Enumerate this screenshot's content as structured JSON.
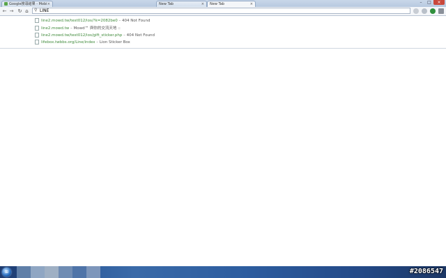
{
  "tabs": [
    {
      "label": "Google搜尋結果 - Mobi",
      "close": "×"
    },
    {
      "label": "New Tab",
      "close": "×"
    },
    {
      "label": "New Tab",
      "close": "×"
    }
  ],
  "window_controls": {
    "minimize": "–",
    "maximize": "□",
    "close": "×"
  },
  "toolbar": {
    "back": "←",
    "forward": "→",
    "reload": "↻",
    "home": "⌂",
    "omnibox_value": "LINE",
    "search_glyph": "⚲"
  },
  "suggestions": [
    {
      "url": "line2.mowd.tw/test012/ios/?k=2082be0",
      "sep": " – ",
      "title": "404 Not Found"
    },
    {
      "url": "line2.mowd.tw",
      "sep": " – ",
      "title": "Mowd™ 與你的交流天地 ::"
    },
    {
      "url": "line2.mowd.tw/test012/ios/gift_sticker.php",
      "sep": " – ",
      "title": "404 Not Found"
    },
    {
      "url": "lifebox.twbbs.org/Line/index",
      "sep": " – ",
      "title": "Lion Sticker Box"
    }
  ],
  "taskbar": {
    "start_glyph": "⊞",
    "watermark": "#2086547"
  },
  "colors": {
    "url_green": "#3f8a3a",
    "taskbar_blue": "#2c5a9a"
  }
}
